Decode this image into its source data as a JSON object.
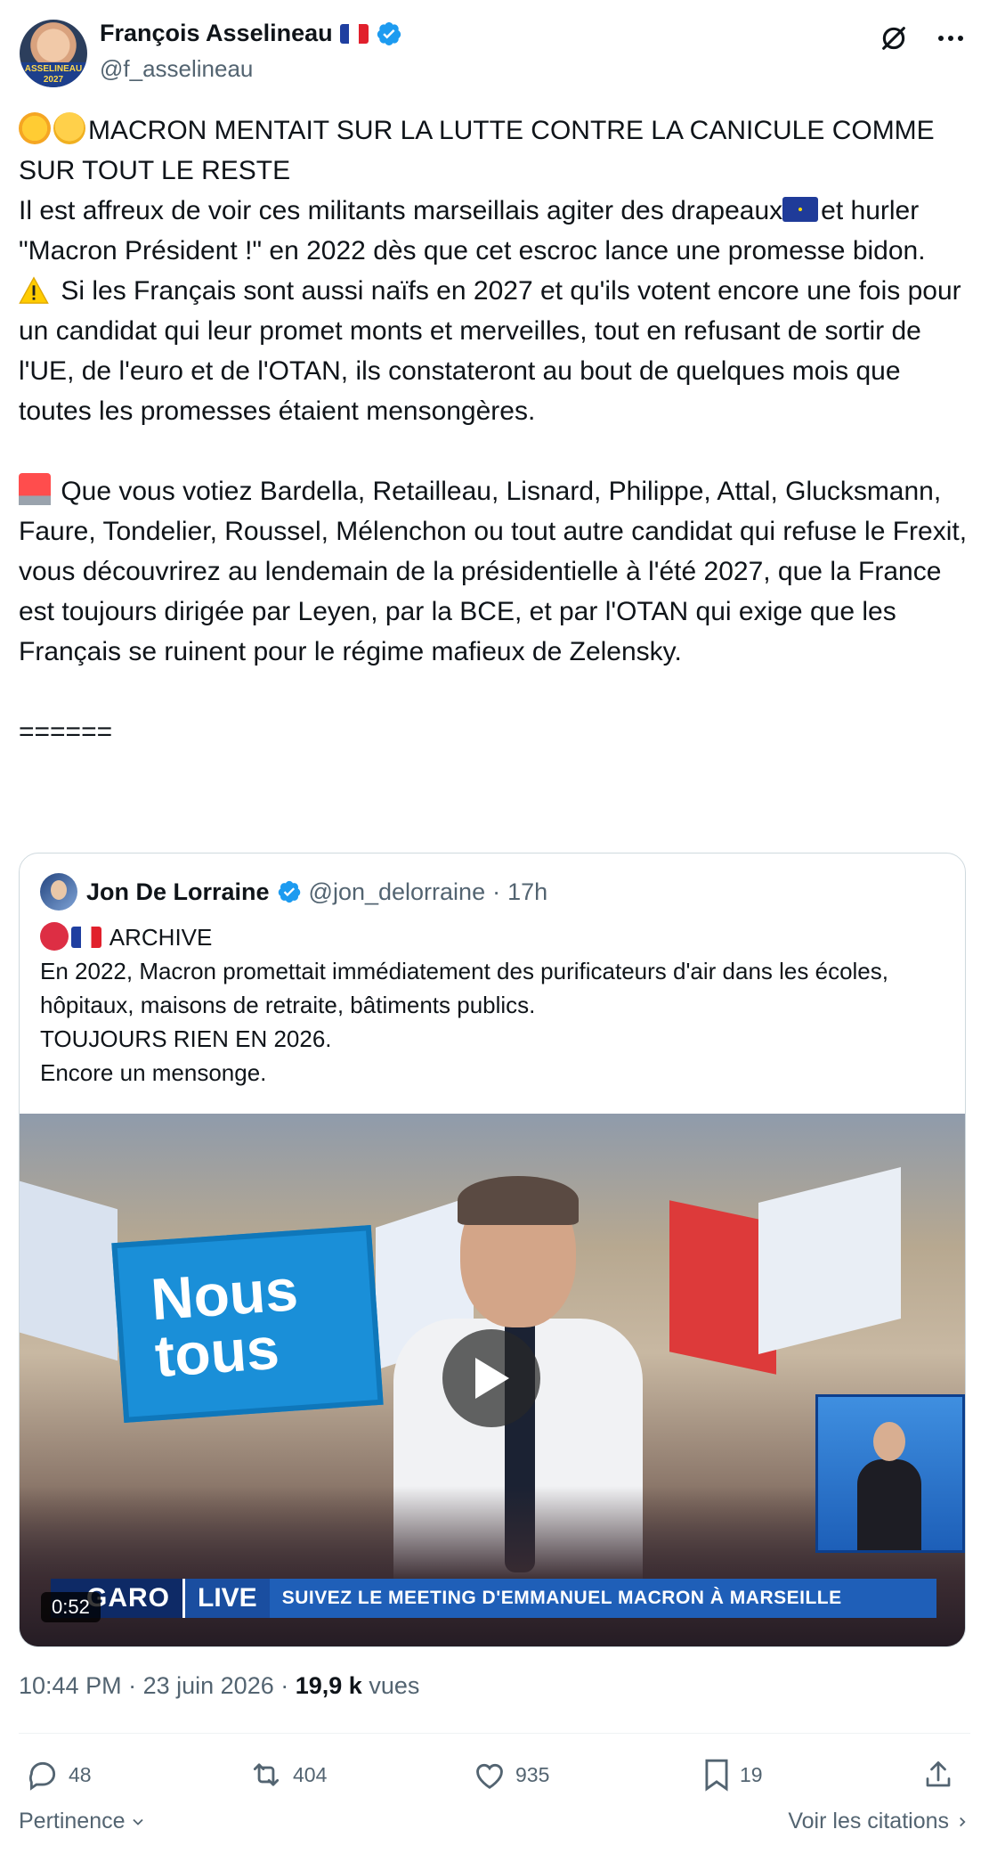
{
  "author": {
    "name": "François Asselineau",
    "handle": "@f_asselineau",
    "avatar_text": "ASSELINEAU 2027",
    "flag_icon": "french-flag-icon",
    "verified_color": "#1d9bf0"
  },
  "tweet": {
    "lines": [
      "MACRON MENTAIT SUR LA LUTTE CONTRE LA CANICULE COMME SUR TOUT LE RESTE",
      "Il est affreux de voir ces militants marseillais agiter des drapeaux",
      "et hurler \"Macron Président !\" en 2022 dès que cet escroc lance une promesse bidon.",
      " Si les Français sont aussi naïfs en 2027 et qu'ils votent encore une fois pour un candidat qui leur promet monts et merveilles, tout en refusant de sortir de l'UE, de l'euro et de l'OTAN, ils constateront au bout de quelques mois que toutes les promesses étaient mensongères.",
      " Que vous votiez Bardella, Retailleau, Lisnard, Philippe, Attal, Glucksmann, Faure, Tondelier, Roussel, Mélenchon ou tout autre candidat qui refuse le Frexit, vous découvrirez au lendemain de la présidentielle à l'été 2027, que la France est toujours dirigée par Leyen, par la BCE, et par l'OTAN qui exige que les Français se ruinent pour le régime mafieux de Zelensky.",
      "======"
    ]
  },
  "quote": {
    "name": "Jon De Lorraine",
    "handle": "@jon_delorraine",
    "time": "17h",
    "lines": [
      " ARCHIVE",
      "En 2022, Macron promettait immédiatement des purificateurs d'air dans les écoles, hôpitaux, maisons de retraite, bâtiments publics.",
      "TOUJOURS RIEN EN 2026.",
      "Encore un mensonge."
    ],
    "video": {
      "sign_line1": "Nous",
      "sign_line2": "tous",
      "channel": "GARO",
      "live": "LIVE",
      "caption": "SUIVEZ LE MEETING D'EMMANUEL MACRON À MARSEILLE",
      "duration": "0:52"
    }
  },
  "meta": {
    "time": "10:44 PM",
    "date": "23 juin 2026",
    "views_count": "19,9 k",
    "views_label": "vues"
  },
  "actions": {
    "replies": "48",
    "reposts": "404",
    "likes": "935",
    "bookmarks": "19"
  },
  "footer": {
    "relevance": "Pertinence",
    "view_quotes": "Voir les citations"
  }
}
